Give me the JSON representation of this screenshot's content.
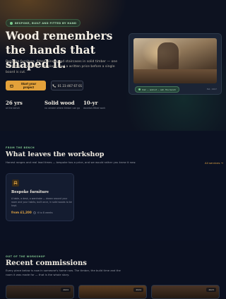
{
  "hero": {
    "badge": "BESPOKE, BUILT AND FITTED BY HAND",
    "title": "Wood remembers the hands that shaped it.",
    "description": "Bespoke furniture, fitted joinery and staircases in solid timber — one workshop, one maker per piece, and a written price before a single board is cut.",
    "primary_button": "Start your project",
    "secondary_button": "01 23 467 67 01",
    "stats": [
      {
        "value": "26 yrs",
        "label": "at the bench"
      },
      {
        "value": "Solid wood",
        "label": "no veneer where timber can go"
      },
      {
        "value": "10-yr",
        "label": "dovetail-fitted work"
      }
    ],
    "photo_card": {
      "tag": "Oak — walnut — ash, the bench",
      "meta": "Est. 1997"
    }
  },
  "services": {
    "eyebrow": "FROM THE BENCH",
    "title": "What leaves the workshop",
    "subtitle": "Honest ranges and real lead times — bespoke has a price, and we would rather you knew it now.",
    "all_link": "All services",
    "cards": [
      {
        "title": "Bespoke furniture",
        "description": "A table, a desk, a wardrobe — drawn around your room and your habits, built once, in solid woods to be kept.",
        "price": "from £1,200",
        "time": "6 to 8 weeks"
      }
    ]
  },
  "commissions": {
    "eyebrow": "OUT OF THE WORKSHOP",
    "title": "Recent commissions",
    "subtitle": "Every piece below is now in someone's home now. The timber, the build time and the room it was made for — that is the whole story.",
    "items": [
      {
        "year": "2024"
      },
      {
        "year": "2024"
      },
      {
        "year": "2023"
      }
    ]
  },
  "colors": {
    "accent": "#e3a13a",
    "green": "#7fc58e",
    "background": "#0c1020"
  }
}
